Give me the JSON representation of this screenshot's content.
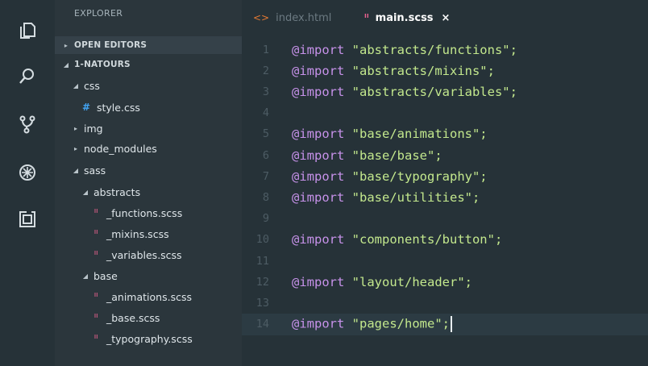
{
  "sidebar": {
    "title": "EXPLORER",
    "tree": [
      {
        "label": "OPEN EDITORS",
        "twisty": "collapsed",
        "kind": "section",
        "indent": 0
      },
      {
        "label": "1-NATOURS",
        "twisty": "expanded",
        "kind": "section",
        "indent": 0
      },
      {
        "label": "css",
        "twisty": "expanded",
        "kind": "folder",
        "indent": 1
      },
      {
        "label": "style.css",
        "kind": "css-file",
        "icon": "#",
        "indent": 2
      },
      {
        "label": "img",
        "twisty": "collapsed",
        "kind": "folder",
        "indent": 1
      },
      {
        "label": "node_modules",
        "twisty": "collapsed",
        "kind": "folder",
        "indent": 1
      },
      {
        "label": "sass",
        "twisty": "expanded",
        "kind": "folder",
        "indent": 1
      },
      {
        "label": "abstracts",
        "twisty": "expanded",
        "kind": "folder",
        "indent": 2
      },
      {
        "label": "_functions.scss",
        "kind": "scss-file",
        "icon": "ᐦ",
        "indent": 3
      },
      {
        "label": "_mixins.scss",
        "kind": "scss-file",
        "icon": "ᐦ",
        "indent": 3
      },
      {
        "label": "_variables.scss",
        "kind": "scss-file",
        "icon": "ᐦ",
        "indent": 3
      },
      {
        "label": "base",
        "twisty": "expanded",
        "kind": "folder",
        "indent": 2
      },
      {
        "label": "_animations.scss",
        "kind": "scss-file",
        "icon": "ᐦ",
        "indent": 3
      },
      {
        "label": "_base.scss",
        "kind": "scss-file",
        "icon": "ᐦ",
        "indent": 3
      },
      {
        "label": "_typography.scss",
        "kind": "scss-file",
        "icon": "ᐦ",
        "indent": 3
      }
    ]
  },
  "activity_bar": {
    "icons": [
      "files-icon",
      "search-icon",
      "source-control-icon",
      "debug-icon",
      "extensions-icon"
    ]
  },
  "tabs": [
    {
      "label": "index.html",
      "icon": "<>",
      "active": false
    },
    {
      "label": "main.scss",
      "icon": "ᐦ",
      "active": true,
      "close": "×"
    }
  ],
  "editor": {
    "current_line": 14,
    "lines": [
      {
        "n": "1",
        "kw": "@import",
        "str": "\"abstracts/functions\";"
      },
      {
        "n": "2",
        "kw": "@import",
        "str": "\"abstracts/mixins\";"
      },
      {
        "n": "3",
        "kw": "@import",
        "str": "\"abstracts/variables\";"
      },
      {
        "n": "4",
        "kw": "",
        "str": ""
      },
      {
        "n": "5",
        "kw": "@import",
        "str": "\"base/animations\";"
      },
      {
        "n": "6",
        "kw": "@import",
        "str": "\"base/base\";"
      },
      {
        "n": "7",
        "kw": "@import",
        "str": "\"base/typography\";"
      },
      {
        "n": "8",
        "kw": "@import",
        "str": "\"base/utilities\";"
      },
      {
        "n": "9",
        "kw": "",
        "str": ""
      },
      {
        "n": "10",
        "kw": "@import",
        "str": "\"components/button\";"
      },
      {
        "n": "11",
        "kw": "",
        "str": ""
      },
      {
        "n": "12",
        "kw": "@import",
        "str": "\"layout/header\";"
      },
      {
        "n": "13",
        "kw": "",
        "str": ""
      },
      {
        "n": "14",
        "kw": "@import",
        "str": "\"pages/home\";"
      }
    ]
  },
  "colors": {
    "background": "#263238",
    "sidebar": "#2b363c",
    "keyword": "#c792ea",
    "string": "#c3e88d",
    "line_number": "#4d5c64",
    "scss_icon": "#f06292",
    "css_icon": "#42a5f5",
    "html_icon": "#e37933"
  }
}
